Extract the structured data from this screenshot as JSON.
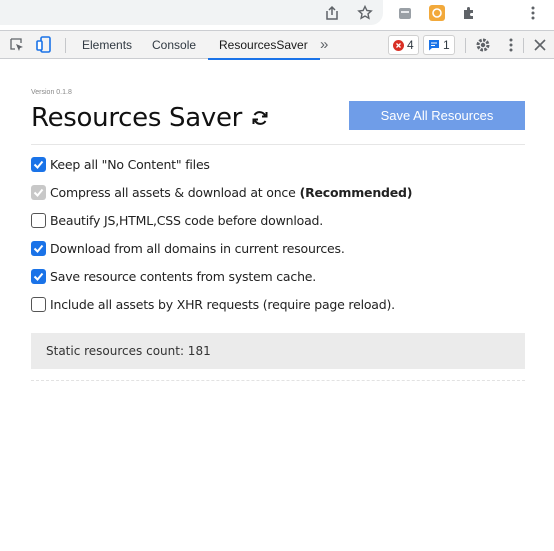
{
  "devtools": {
    "tabs": [
      "Elements",
      "Console",
      "ResourcesSaver"
    ],
    "active_tab": "ResourcesSaver",
    "more_tabs_glyph": "»",
    "error_count": "4",
    "message_count": "1",
    "icons": [
      "inspect-element-icon",
      "device-toolbar-icon",
      "settings-gear-icon",
      "kebab-menu-icon",
      "close-icon"
    ]
  },
  "browser": {
    "icons": [
      "share-icon",
      "bookmark-star-icon",
      "extension-one-icon",
      "extension-two-icon",
      "puzzle-extensions-icon",
      "browser-menu-icon"
    ]
  },
  "panel": {
    "version": "Version 0.1.8",
    "title": "Resources Saver",
    "save_button": "Save All Resources",
    "options": [
      {
        "label": "Keep all \"No Content\" files",
        "state": "checked",
        "emphasis": ""
      },
      {
        "label": "Compress all assets & download at once",
        "state": "checked-disabled",
        "emphasis": "(Recommended)"
      },
      {
        "label": "Beautify JS,HTML,CSS code before download.",
        "state": "unchecked",
        "emphasis": ""
      },
      {
        "label": "Download from all domains in current resources.",
        "state": "checked",
        "emphasis": ""
      },
      {
        "label": "Save resource contents from system cache.",
        "state": "checked",
        "emphasis": ""
      },
      {
        "label": "Include all assets by XHR requests (require page reload).",
        "state": "unchecked",
        "emphasis": ""
      }
    ],
    "static_count_label": "Static resources count: 181"
  },
  "colors": {
    "accent": "#1a73e8",
    "save_button_bg": "#6f9de8",
    "error_red": "#d93025",
    "toolbar_bg": "#f3f3f3"
  }
}
